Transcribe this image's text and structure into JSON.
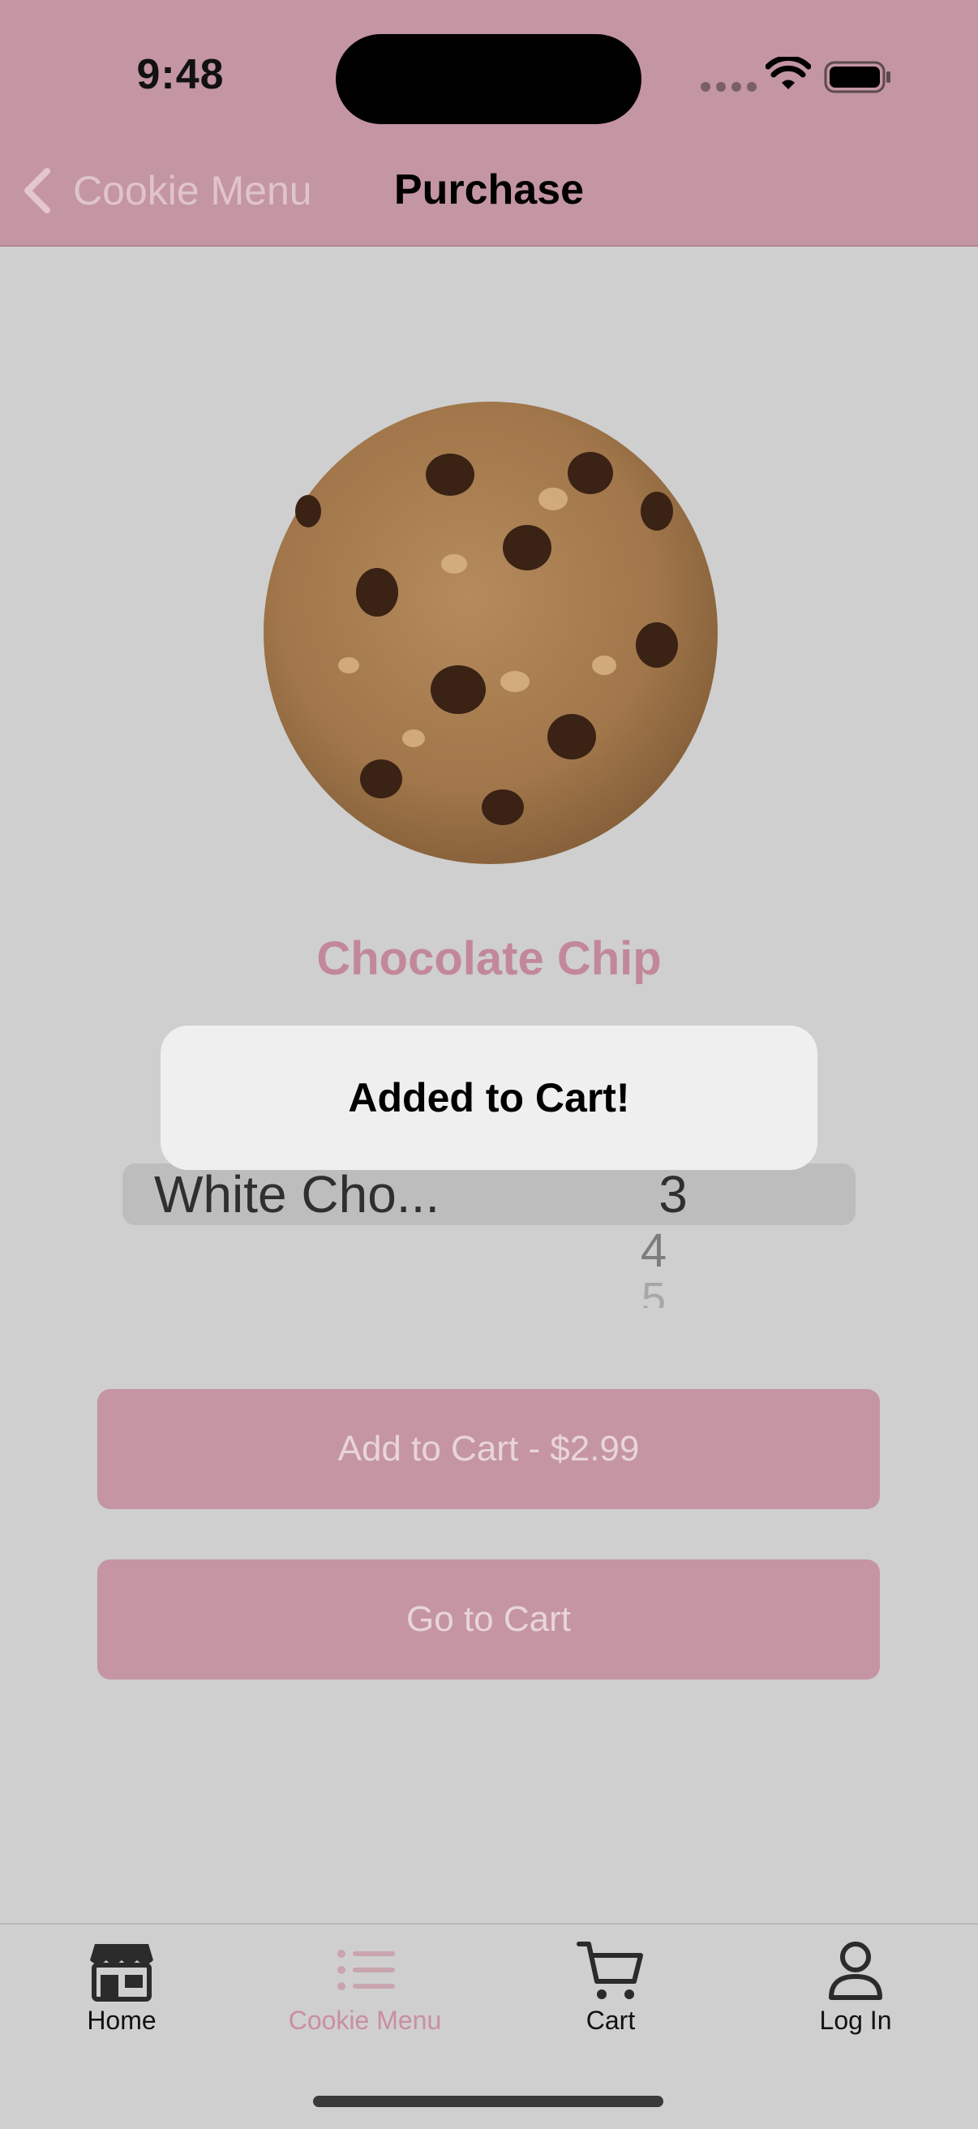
{
  "status_bar": {
    "time": "9:48"
  },
  "nav": {
    "back_label": "Cookie Menu",
    "title": "Purchase"
  },
  "product": {
    "name": "Chocolate Chip"
  },
  "picker": {
    "selected_flavor": "White Cho...",
    "selected_quantity": "3",
    "next_quantity": "4",
    "next_next_quantity": "5"
  },
  "buttons": {
    "add_to_cart": "Add to Cart - $2.99",
    "go_to_cart": "Go to Cart"
  },
  "alert": {
    "message": "Added to Cart!"
  },
  "tabs": [
    {
      "label": "Home",
      "icon": "storefront-icon"
    },
    {
      "label": "Cookie Menu",
      "icon": "list-icon",
      "active": true
    },
    {
      "label": "Cart",
      "icon": "cart-icon"
    },
    {
      "label": "Log In",
      "icon": "person-icon"
    }
  ],
  "colors": {
    "accent": "#c495a2",
    "title_accent": "#c28899",
    "background": "#cfcfcf"
  }
}
